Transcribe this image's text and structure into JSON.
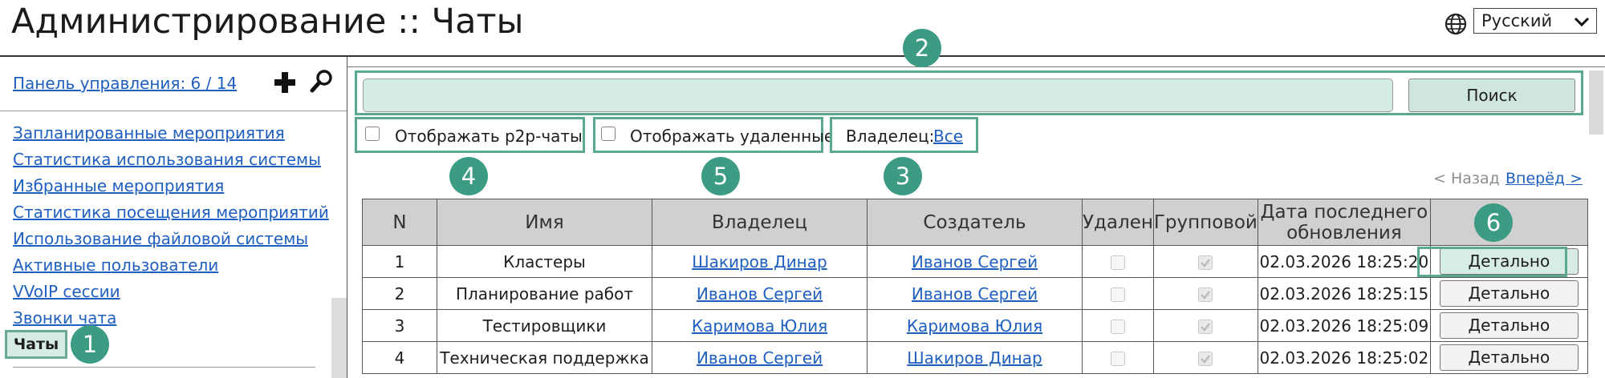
{
  "header": {
    "title": "Администрирование :: Чаты",
    "language": "Русский"
  },
  "sidebar": {
    "panel_link": "Панель управления: 6 / 14",
    "items": [
      {
        "label": "Запланированные мероприятия"
      },
      {
        "label": "Статистика использования системы"
      },
      {
        "label": "Избранные мероприятия"
      },
      {
        "label": "Статистика посещения мероприятий"
      },
      {
        "label": "Использование файловой системы"
      },
      {
        "label": "Активные пользователи"
      },
      {
        "label": "VVoIP сессии"
      },
      {
        "label": "Звонки чата"
      }
    ],
    "active_item": "Чаты"
  },
  "markers": [
    "1",
    "2",
    "3",
    "4",
    "5",
    "6"
  ],
  "search": {
    "value": "",
    "button_label": "Поиск"
  },
  "filters": {
    "p2p_label": "Отображать p2p-чаты",
    "p2p_checked": false,
    "deleted_label": "Отображать удаленные",
    "deleted_checked": false,
    "owner_label": "Владелец:",
    "owner_value": "Все"
  },
  "pager": {
    "prev": "< Назад",
    "next": "Вперёд >"
  },
  "table": {
    "columns": [
      "N",
      "Имя",
      "Владелец",
      "Создатель",
      "Удален",
      "Групповой",
      "Дата последнего обновления",
      ""
    ],
    "rows": [
      {
        "n": "1",
        "name": "Кластеры",
        "owner": "Шакиров Динар",
        "creator": "Иванов Сергей",
        "deleted": false,
        "group": true,
        "updated": "02.03.2026 18:25:20",
        "action": "Детально"
      },
      {
        "n": "2",
        "name": "Планирование работ",
        "owner": "Иванов Сергей",
        "creator": "Иванов Сергей",
        "deleted": false,
        "group": true,
        "updated": "02.03.2026 18:25:15",
        "action": "Детально"
      },
      {
        "n": "3",
        "name": "Тестировщики",
        "owner": "Каримова Юлия",
        "creator": "Каримова Юлия",
        "deleted": false,
        "group": true,
        "updated": "02.03.2026 18:25:09",
        "action": "Детально"
      },
      {
        "n": "4",
        "name": "Техническая поддержка",
        "owner": "Иванов Сергей",
        "creator": "Шакиров Динар",
        "deleted": false,
        "group": true,
        "updated": "02.03.2026 18:25:02",
        "action": "Детально"
      }
    ]
  },
  "colors": {
    "accent": "#3b9b83",
    "highlight_border": "#5aa88f",
    "link": "#1f5fbf",
    "header_bg": "#d0d0d0"
  },
  "icons": {
    "language": "globe-icon",
    "add": "plus-icon",
    "search": "magnifier-icon",
    "select": "chevron-down-icon"
  }
}
